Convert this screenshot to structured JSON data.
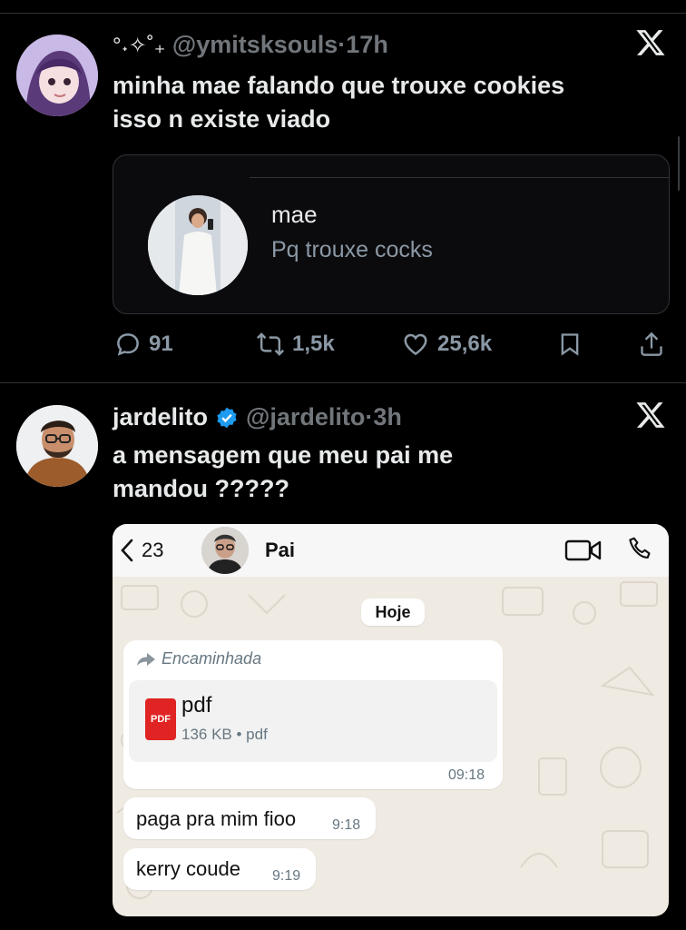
{
  "tweets": [
    {
      "handle": "@ymitsksouls",
      "decor": "°˖✧˚₊",
      "time": "17h",
      "text_line1": "minha mae falando que trouxe cookies",
      "text_line2": "isso n existe viado",
      "quote": {
        "name": "mae",
        "message": "Pq trouxe cocks"
      },
      "stats": {
        "replies": "91",
        "retweets": "1,5k",
        "likes": "25,6k"
      }
    },
    {
      "name": "jardelito",
      "handle": "@jardelito",
      "time": "3h",
      "verified": true,
      "text_line1": "a mensagem que meu pai me",
      "text_line2": "mandou ?????"
    }
  ],
  "whatsapp": {
    "back_count": "23",
    "contact": "Pai",
    "date_chip": "Hoje",
    "forwarded_label": "Encaminhada",
    "file": {
      "icon_label": "PDF",
      "name": "pdf",
      "meta": "136 KB • pdf",
      "time": "09:18"
    },
    "messages": [
      {
        "text": "paga pra mim fioo",
        "time": "9:18"
      },
      {
        "text": "kerry coude",
        "time": "9:19"
      }
    ]
  },
  "dot": "·",
  "colors": {
    "background": "#000000",
    "muted": "#71767b",
    "verified": "#1d9bf0",
    "wa_bg": "#efeae2",
    "pdf_red": "#e02424"
  }
}
